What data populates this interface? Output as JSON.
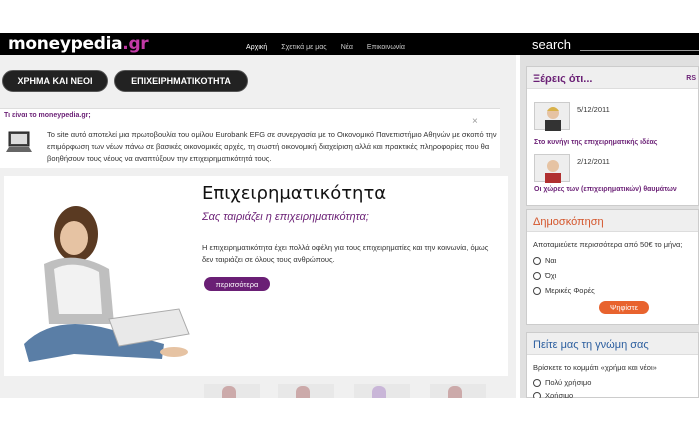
{
  "header": {
    "logo_main": "moneypedia",
    "logo_suffix": ".gr",
    "nav": [
      "Αρχική",
      "Σχετικά με μας",
      "Νέα",
      "Επικοινωνία"
    ],
    "search_label": "search"
  },
  "tabs": [
    "ΧΡΗΜΑ ΚΑΙ ΝΕΟΙ",
    "ΕΠΙΧΕΙΡΗΜΑΤΙΚΟΤΗΤΑ"
  ],
  "info": {
    "title": "Τι είναι το moneypedia.gr;",
    "close": "×",
    "text": "Το site αυτό αποτελεί μια πρωτοβουλία του ομίλου Eurobank EFG σε συνεργασία με το Οικονομικό Πανεπιστήμιο Αθηνών με σκοπό την επιμόρφωση των νέων πάνω σε βασικές οικονομικές αρχές, τη σωστή οικονομική διαχείριση αλλά και πρακτικές πληροφορίες που θα βοηθήσουν τους νέους να αναπτύξουν την επιχειρηματικότητά τους."
  },
  "hero": {
    "title": "Επιχειρηματικότητα",
    "subtitle": "Σας ταιριάζει η επιχειρηματικότητα;",
    "text": "Η επιχειρηματικότητα έχει πολλά οφέλη για τους επιχειρηματίες και την κοινωνία, όμως δεν ταιριάζει σε όλους τους ανθρώπους.",
    "button": "περισσότερα"
  },
  "sidebar": {
    "didyouknow": {
      "title": "Ξέρεις ότι...",
      "rss": "RS",
      "items": [
        {
          "date": "5/12/2011",
          "title": "Στο κυνήγι της επιχειρηματικής ιδέας"
        },
        {
          "date": "2/12/2011",
          "title": "Οι χώρες των (επιχειρηματικών) θαυμάτων"
        }
      ]
    },
    "poll": {
      "title": "Δημοσκόπηση",
      "question": "Αποταμιεύετε περισσότερα από 50€ το μήνα;",
      "options": [
        "Ναι",
        "Όχι",
        "Μερικές Φορές"
      ],
      "button": "Ψηφίστε"
    },
    "opinion": {
      "title": "Πείτε μας τη γνώμη σας",
      "question": "Βρίσκετε το κομμάτι «χρήμα και νέοι»",
      "options": [
        "Πολύ χρήσιμο",
        "Χρήσιμο"
      ]
    }
  },
  "colors": {
    "purple": "#6a1f75",
    "orange": "#e8632e",
    "blue": "#2a5d9e"
  }
}
